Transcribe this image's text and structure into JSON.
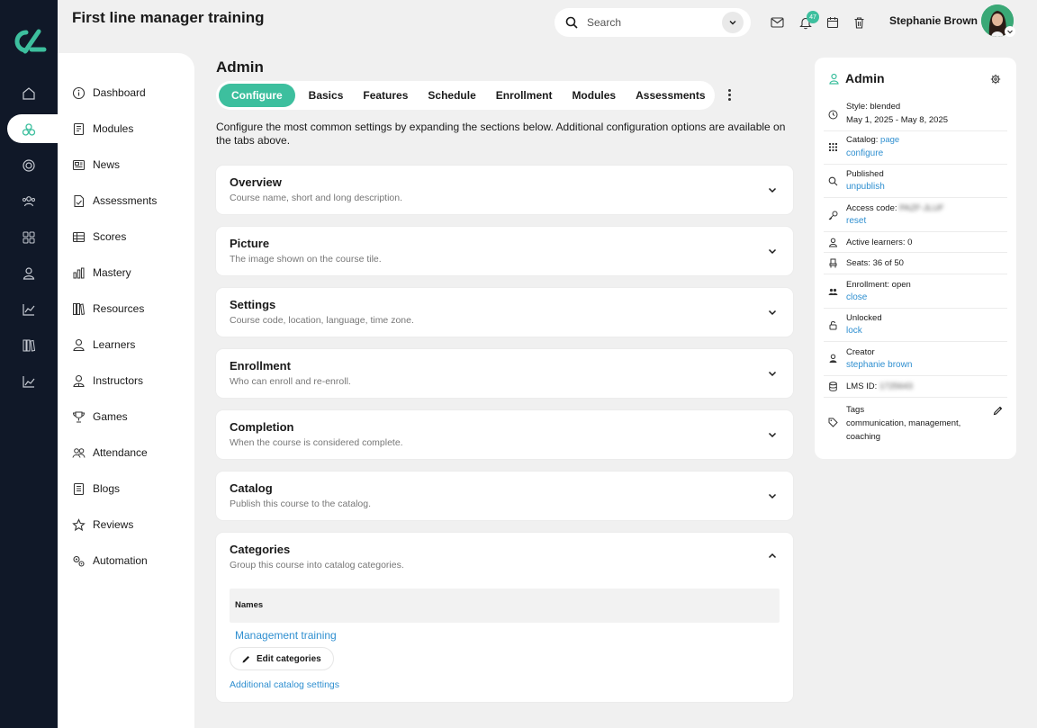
{
  "colors": {
    "rail_bg": "#101828",
    "accent": "#3dbf9e",
    "link": "#2f8fd0",
    "page_bg": "#f0f0f0"
  },
  "header": {
    "title": "First line manager training",
    "search_placeholder": "Search",
    "notification_count": "47",
    "user_name": "Stephanie Brown"
  },
  "rail": {
    "icons": [
      "home-icon",
      "modules-icon",
      "target-icon",
      "people-icon",
      "grid-icon",
      "person-icon",
      "chart-icon",
      "library-icon",
      "analytics-icon"
    ],
    "active_index": 1
  },
  "sidebar": {
    "items": [
      {
        "label": "Dashboard",
        "icon": "info-icon"
      },
      {
        "label": "Modules",
        "icon": "book-icon"
      },
      {
        "label": "News",
        "icon": "news-icon"
      },
      {
        "label": "Assessments",
        "icon": "assessment-icon"
      },
      {
        "label": "Scores",
        "icon": "table-icon"
      },
      {
        "label": "Mastery",
        "icon": "bar-chart-icon"
      },
      {
        "label": "Resources",
        "icon": "library-icon"
      },
      {
        "label": "Learners",
        "icon": "person-icon"
      },
      {
        "label": "Instructors",
        "icon": "instructor-icon"
      },
      {
        "label": "Games",
        "icon": "trophy-icon"
      },
      {
        "label": "Attendance",
        "icon": "group-icon"
      },
      {
        "label": "Blogs",
        "icon": "blog-icon"
      },
      {
        "label": "Reviews",
        "icon": "star-icon"
      },
      {
        "label": "Automation",
        "icon": "gears-icon"
      }
    ]
  },
  "main": {
    "heading": "Admin",
    "tabs": [
      "Configure",
      "Basics",
      "Features",
      "Schedule",
      "Enrollment",
      "Modules",
      "Assessments"
    ],
    "active_tab": "Configure",
    "intro": "Configure the most common settings by expanding the sections below. Additional configuration options are available on the tabs above.",
    "sections": [
      {
        "title": "Overview",
        "subtitle": "Course name, short and long description.",
        "expanded": false
      },
      {
        "title": "Picture",
        "subtitle": "The image shown on the course tile.",
        "expanded": false
      },
      {
        "title": "Settings",
        "subtitle": "Course code, location, language, time zone.",
        "expanded": false
      },
      {
        "title": "Enrollment",
        "subtitle": "Who can enroll and re-enroll.",
        "expanded": false
      },
      {
        "title": "Completion",
        "subtitle": "When the course is considered complete.",
        "expanded": false
      },
      {
        "title": "Catalog",
        "subtitle": "Publish this course to the catalog.",
        "expanded": false
      },
      {
        "title": "Categories",
        "subtitle": "Group this course into catalog categories.",
        "expanded": true
      }
    ],
    "categories": {
      "table_header": "Names",
      "items": [
        "Management training"
      ],
      "edit_button": "Edit categories",
      "additional_link": "Additional catalog settings"
    }
  },
  "panel": {
    "title": "Admin",
    "rows": [
      {
        "icon": "clock-icon",
        "line1": "Style: blended",
        "line2": "May 1, 2025 - May 8, 2025"
      },
      {
        "icon": "grid-icon",
        "line1": "Catalog:",
        "inline_link": "page",
        "line2": "configure"
      },
      {
        "icon": "search-icon",
        "line1": "Published",
        "line2": "unpublish"
      },
      {
        "icon": "key-icon",
        "line1": "Access code:",
        "blurred": "PAZF-JLUF",
        "line2": "reset"
      },
      {
        "icon": "person-icon",
        "line1": "Active learners: 0"
      },
      {
        "icon": "seat-icon",
        "line1": "Seats: 36 of 50"
      },
      {
        "icon": "group-icon",
        "line1": "Enrollment: open",
        "line2": "close"
      },
      {
        "icon": "unlock-icon",
        "line1": "Unlocked",
        "line2": "lock"
      },
      {
        "icon": "creator-icon",
        "line1": "Creator",
        "line2": "stephanie brown"
      },
      {
        "icon": "database-icon",
        "line1": "LMS ID:",
        "blurred": "1725643"
      },
      {
        "icon": "tag-icon",
        "line1": "Tags",
        "tags": "communication, management, coaching"
      }
    ]
  }
}
